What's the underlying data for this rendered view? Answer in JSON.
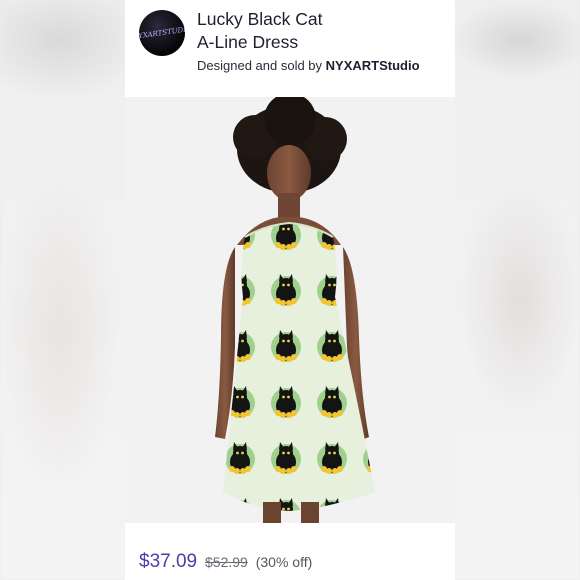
{
  "product": {
    "title_line1": "Lucky Black Cat",
    "title_line2": "A-Line Dress",
    "seller_prefix": "Designed and sold by",
    "seller_name": "NYXARTStudio",
    "avatar_text": "NYXARTSTUDIO"
  },
  "pricing": {
    "price": "$37.09",
    "original_price": "$52.99",
    "discount": "(30% off)"
  },
  "colors": {
    "price_accent": "#4a3fa8",
    "dress_background": "#e6f0dc",
    "cat_badge_green": "#9fd18e",
    "flower_yellow": "#f2c531"
  },
  "image": {
    "subject": "model-wearing-dress-icon"
  }
}
